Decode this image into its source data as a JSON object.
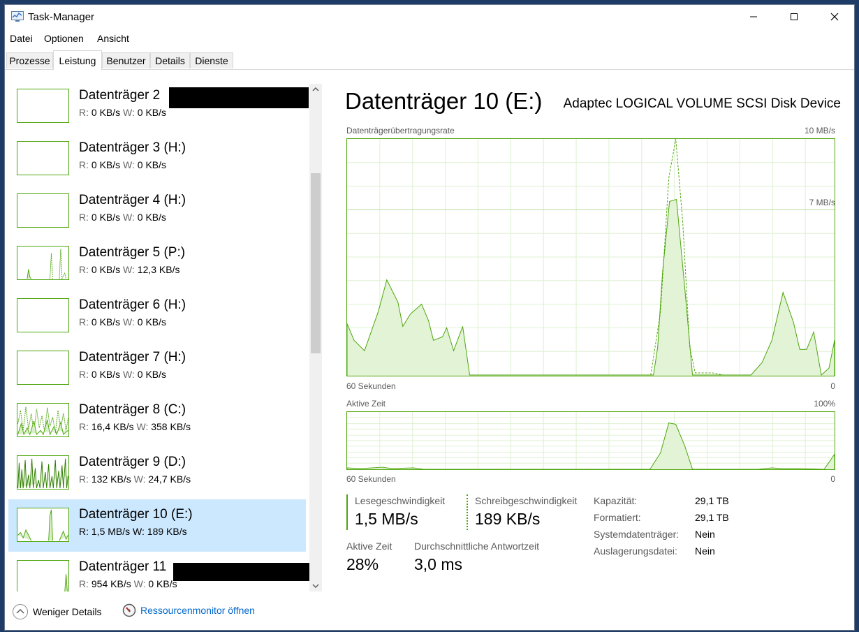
{
  "window": {
    "title": "Task-Manager"
  },
  "menu": [
    "Datei",
    "Optionen",
    "Ansicht"
  ],
  "tabs": [
    "Prozesse",
    "Leistung",
    "Benutzer",
    "Details",
    "Dienste"
  ],
  "disks": [
    {
      "name": "Datenträger 2",
      "r": "0 KB/s",
      "w": "0 KB/s",
      "redacted": true
    },
    {
      "name": "Datenträger 3 (H:)",
      "r": "0 KB/s",
      "w": "0 KB/s"
    },
    {
      "name": "Datenträger 4 (H:)",
      "r": "0 KB/s",
      "w": "0 KB/s"
    },
    {
      "name": "Datenträger 5 (P:)",
      "r": "0 KB/s",
      "w": "12,3 KB/s"
    },
    {
      "name": "Datenträger 6 (H:)",
      "r": "0 KB/s",
      "w": "0 KB/s"
    },
    {
      "name": "Datenträger 7 (H:)",
      "r": "0 KB/s",
      "w": "0 KB/s"
    },
    {
      "name": "Datenträger 8 (C:)",
      "r": "16,4 KB/s",
      "w": "358 KB/s"
    },
    {
      "name": "Datenträger 9 (D:)",
      "r": "132 KB/s",
      "w": "24,7 KB/s"
    },
    {
      "name": "Datenträger 10 (E:)",
      "r": "1,5 MB/s",
      "w": "189 KB/s",
      "selected": true
    },
    {
      "name": "Datenträger 11",
      "r": "954 KB/s",
      "w": "0 KB/s",
      "redacted": true
    }
  ],
  "stat_prefix": {
    "r": "R:",
    "w": "W:"
  },
  "detail": {
    "title": "Datenträger 10 (E:)",
    "device": "Adaptec LOGICAL VOLUME SCSI Disk Device",
    "graph1": {
      "label": "Datenträgerübertragungsrate",
      "max": "10 MB/s",
      "mid": "7 MB/s",
      "time": "60 Sekunden",
      "min": "0"
    },
    "graph2": {
      "label": "Aktive Zeit",
      "max": "100%",
      "time": "60 Sekunden",
      "min": "0"
    },
    "read_label": "Lesegeschwindigkeit",
    "read_value": "1,5 MB/s",
    "write_label": "Schreibgeschwindigkeit",
    "write_value": "189 KB/s",
    "active_label": "Aktive Zeit",
    "active_value": "28%",
    "resp_label": "Durchschnittliche Antwortzeit",
    "resp_value": "3,0 ms",
    "info": [
      {
        "label": "Kapazität:",
        "value": "29,1 TB"
      },
      {
        "label": "Formatiert:",
        "value": "29,1 TB"
      },
      {
        "label": "Systemdatenträger:",
        "value": "Nein"
      },
      {
        "label": "Auslagerungsdatei:",
        "value": "Nein"
      }
    ]
  },
  "footer": {
    "fewer_details": "Weniger Details",
    "resource_monitor": "Ressourcenmonitor öffnen"
  },
  "colors": {
    "accent_green": "#4da60c",
    "selection": "#cce8ff",
    "link": "#0066cc"
  }
}
